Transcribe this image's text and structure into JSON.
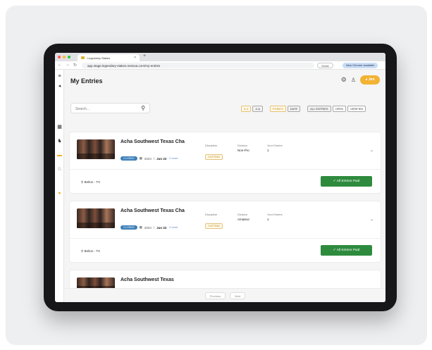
{
  "browser": {
    "tab_title": "Legendary Stakes",
    "tab_close": "×",
    "new_tab": "+",
    "url": "app.stage.legendary-stakes.metova.com/my-entries",
    "guest_label": "Guest",
    "chrome_notice": "New Chrome available",
    "nav_back": "←",
    "nav_forward": "→",
    "nav_reload": "↻"
  },
  "header": {
    "title": "My Entries",
    "user_pill": "● Jen"
  },
  "search": {
    "placeholder": "Search..."
  },
  "filters": {
    "az": "A-Z",
    "za": "Z-A",
    "points": "POINTS",
    "date": "DATE",
    "all_entries": "ALL ENTRIES",
    "open": "OPEN",
    "verified": "VERIFIED"
  },
  "labels": {
    "discipline": "Discipline",
    "division": "Division",
    "your_entries": "Your Entries"
  },
  "entries": [
    {
      "title": "Acha Southwest Texas Cha",
      "badge": "CLOSED",
      "year": "2024",
      "date": "Jun 22",
      "more": "+1 more",
      "discipline": "CUTTING",
      "division": "Non-Pro",
      "your_entries": "1",
      "location": "Belton - TX",
      "status": "All Entries Paid"
    },
    {
      "title": "Acha Southwest Texas Cha",
      "badge": "CLOSED",
      "year": "2024",
      "date": "Jun 22",
      "more": "+1 more",
      "discipline": "CUTTING",
      "division": "Amateur",
      "your_entries": "1",
      "location": "Belton - TX",
      "status": "All Entries Paid"
    },
    {
      "title": "Acha Southwest Texas"
    }
  ],
  "pager": {
    "previous": "Previous",
    "next": "Next"
  },
  "colors": {
    "accent": "#f2b233",
    "paid_green": "#2e8b3e",
    "badge_blue": "#3d7fb8"
  }
}
